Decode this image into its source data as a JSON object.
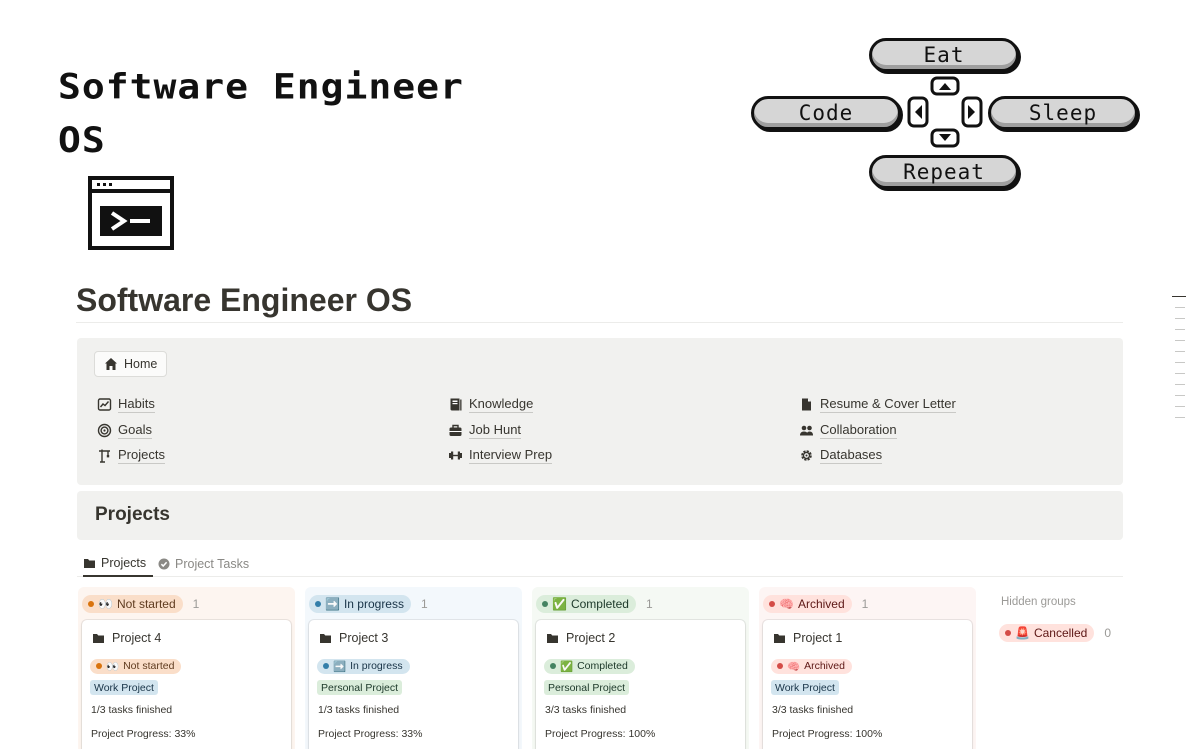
{
  "banner": {
    "title_line1": "Software Engineer",
    "title_line2": "OS",
    "buttons": {
      "up": "Eat",
      "left": "Code",
      "right": "Sleep",
      "down": "Repeat"
    }
  },
  "page_title": "Software Engineer OS",
  "nav": {
    "home": "Home",
    "col1": [
      {
        "label": "Habits",
        "icon": "chart-line-icon"
      },
      {
        "label": "Goals",
        "icon": "target-icon"
      },
      {
        "label": "Projects",
        "icon": "crane-icon"
      }
    ],
    "col2": [
      {
        "label": "Knowledge",
        "icon": "book-icon"
      },
      {
        "label": "Job Hunt",
        "icon": "briefcase-icon"
      },
      {
        "label": "Interview Prep",
        "icon": "dumbbell-icon"
      }
    ],
    "col3": [
      {
        "label": "Resume & Cover Letter",
        "icon": "document-icon"
      },
      {
        "label": "Collaboration",
        "icon": "people-icon"
      },
      {
        "label": "Databases",
        "icon": "gear-icon"
      }
    ]
  },
  "projects_heading": "Projects",
  "tabs": [
    {
      "label": "Projects",
      "icon": "folder-icon",
      "active": true
    },
    {
      "label": "Project Tasks",
      "icon": "check-circle-icon",
      "active": false
    }
  ],
  "columns": [
    {
      "status": "Not started",
      "emoji": "👀",
      "count": "1",
      "bg": "#fdf5f0",
      "pill_bg": "#fadec9",
      "pill_text": "#5f3b1f",
      "dot": "#d9730d",
      "card": {
        "title": "Project 4",
        "tag": "Work Project",
        "tag_bg": "#d3e5ef",
        "tag_text": "#183347",
        "tasks": "1/3 tasks finished",
        "progress": "Project Progress: 33%"
      }
    },
    {
      "status": "In progress",
      "emoji": "➡️",
      "count": "1",
      "bg": "#f3f8fc",
      "pill_bg": "#d3e5ef",
      "pill_text": "#183347",
      "dot": "#337ea9",
      "card": {
        "title": "Project 3",
        "tag": "Personal Project",
        "tag_bg": "#dbeddb",
        "tag_text": "#1c3829",
        "tasks": "1/3 tasks finished",
        "progress": "Project Progress: 33%"
      }
    },
    {
      "status": "Completed",
      "emoji": "✅",
      "count": "1",
      "bg": "#f5f9f4",
      "pill_bg": "#dbeddb",
      "pill_text": "#1c3829",
      "dot": "#448361",
      "card": {
        "title": "Project 2",
        "tag": "Personal Project",
        "tag_bg": "#dbeddb",
        "tag_text": "#1c3829",
        "tasks": "3/3 tasks finished",
        "progress": "Project Progress: 100%"
      }
    },
    {
      "status": "Archived",
      "emoji": "🧠",
      "count": "1",
      "bg": "#fdf5f4",
      "pill_bg": "#ffe2dd",
      "pill_text": "#5d1715",
      "dot": "#d44c47",
      "card": {
        "title": "Project 1",
        "tag": "Work Project",
        "tag_bg": "#d3e5ef",
        "tag_text": "#183347",
        "tasks": "3/3 tasks finished",
        "progress": "Project Progress: 100%"
      }
    }
  ],
  "hidden_groups": {
    "label": "Hidden groups",
    "items": [
      {
        "status": "Cancelled",
        "emoji": "🚨",
        "count": "0"
      }
    ]
  }
}
